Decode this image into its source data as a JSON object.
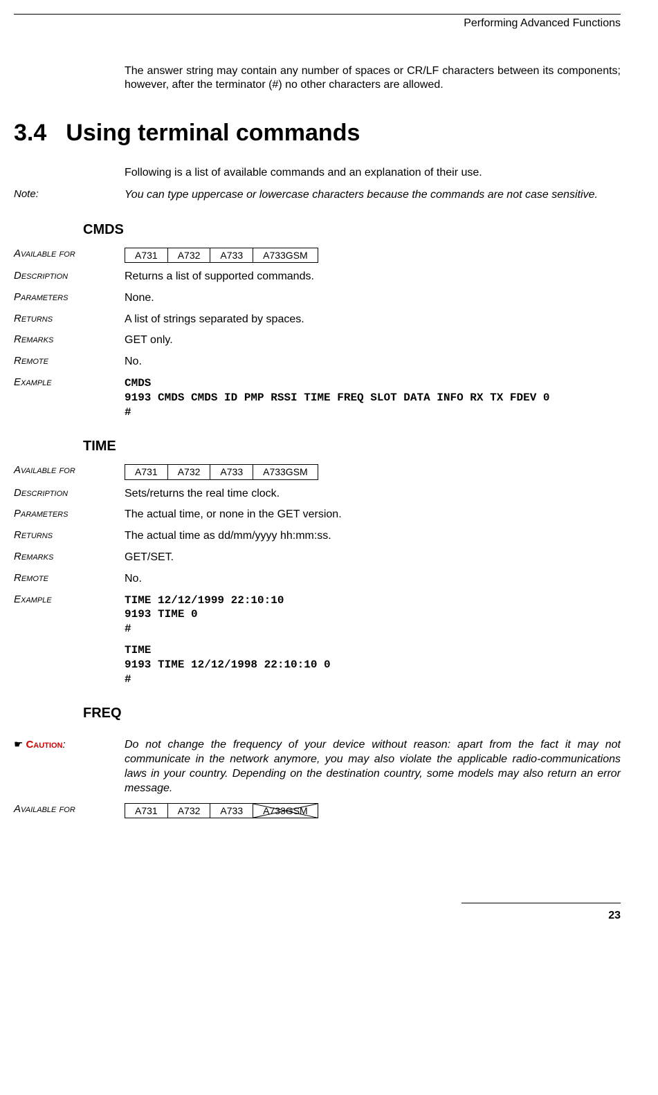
{
  "running_head": "Performing Advanced Functions",
  "intro_paragraph": "The answer string may contain any number of spaces or CR/LF characters between its components; however, after the terminator (#) no other characters are allowed.",
  "section": {
    "number": "3.4",
    "title": "Using terminal commands"
  },
  "following_text": "Following is a list of available commands and an explanation of their use.",
  "note_label": "Note:",
  "note_text": "You can type uppercase or lowercase characters because the commands are not case sensitive.",
  "labels": {
    "available_for": "Available for",
    "description": "Description",
    "parameters": "Parameters",
    "returns": "Returns",
    "remarks": "Remarks",
    "remote": "Remote",
    "example": "Example"
  },
  "cmds": {
    "heading": "CMDS",
    "available": [
      "A731",
      "A732",
      "A733",
      "A733GSM"
    ],
    "description": "Returns a list of supported commands.",
    "parameters": "None.",
    "returns": "A list of strings separated by spaces.",
    "remarks": "GET only.",
    "remote": "No.",
    "example": "CMDS\n9193 CMDS CMDS ID PMP RSSI TIME FREQ SLOT DATA INFO RX TX FDEV 0\n#"
  },
  "time": {
    "heading": "TIME",
    "available": [
      "A731",
      "A732",
      "A733",
      "A733GSM"
    ],
    "description": "Sets/returns the real time clock.",
    "parameters": "The actual time, or none in the GET version.",
    "returns": "The actual time as dd/mm/yyyy hh:mm:ss.",
    "remarks": "GET/SET.",
    "remote": "No.",
    "example1": "TIME 12/12/1999 22:10:10\n9193 TIME 0\n#",
    "example2": "TIME\n9193 TIME 12/12/1998 22:10:10 0\n#"
  },
  "freq": {
    "heading": "FREQ",
    "caution_icon": "☛",
    "caution_label": "Caution",
    "caution_colon": ":",
    "caution_text": "Do not change the frequency of your device without reason: apart from the fact it may not communicate in the network anymore, you may also violate the applicable radio-communications laws in your country. Depending on the destination country, some models may also return an error message.",
    "available": [
      "A731",
      "A732",
      "A733",
      "A733GSM"
    ],
    "struck": 3
  },
  "page_number": "23"
}
